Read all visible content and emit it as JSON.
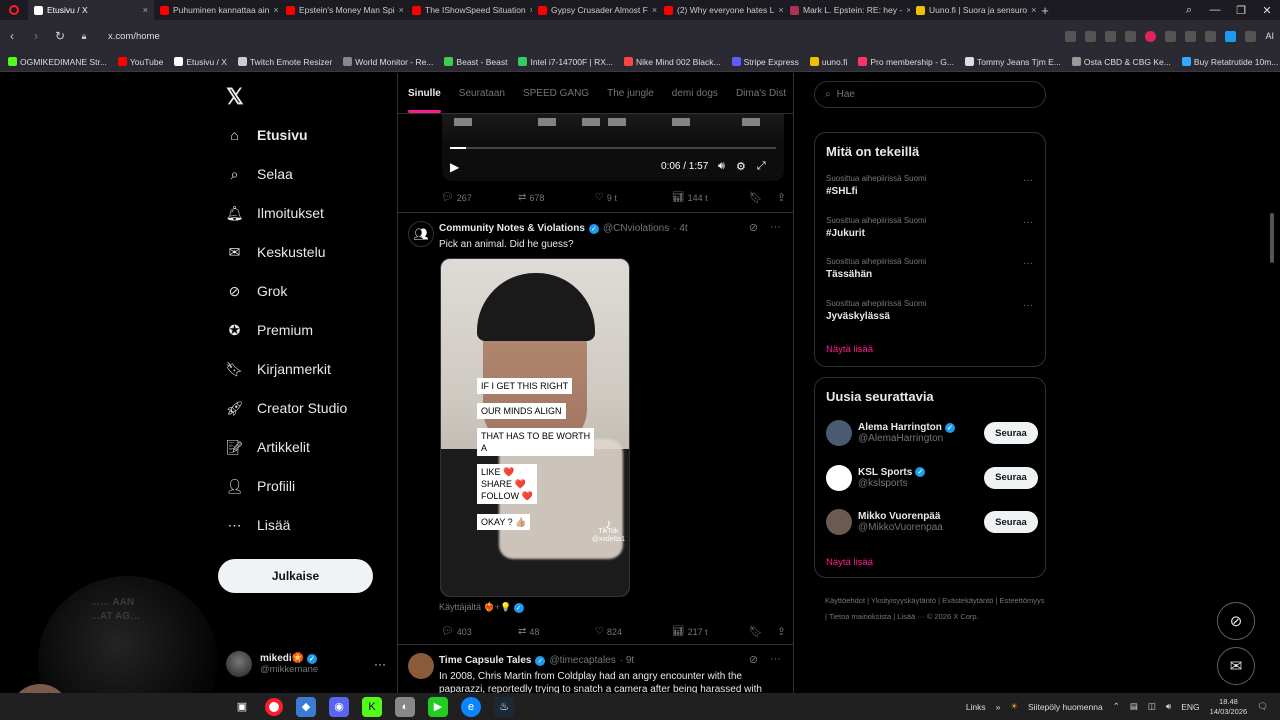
{
  "browser": {
    "tabs": [
      {
        "title": "Etusivu / X",
        "color": "#ffffff",
        "active": true
      },
      {
        "title": "Puhuminen kannattaa ain",
        "color": "#ff0000",
        "active": false
      },
      {
        "title": "Epstein's Money Man Spi",
        "color": "#ff0000",
        "active": false
      },
      {
        "title": "The IShowSpeed Situation",
        "color": "#ff0000",
        "active": false
      },
      {
        "title": "Gypsy Crusader Almost F",
        "color": "#ff0000",
        "active": false
      },
      {
        "title": "(2) Why everyone hates L",
        "color": "#ff0000",
        "active": false
      },
      {
        "title": "Mark L. Epstein: RE: hey -",
        "color": "#aa3355",
        "active": false
      },
      {
        "title": "Uuno.fi | Suora ja sensuro",
        "color": "#f0c000",
        "active": false
      }
    ],
    "url": "x.com/home",
    "ai_label": "AI",
    "bookmarks": [
      {
        "label": "OGMIKEDIMANE Str...",
        "color": "#53fc18"
      },
      {
        "label": "YouTube",
        "color": "#ff0000"
      },
      {
        "label": "Etusivu / X",
        "color": "#ffffff"
      },
      {
        "label": "Twitch Emote Resizer",
        "color": "#cccccc"
      },
      {
        "label": "World Monitor - Re...",
        "color": "#888888"
      },
      {
        "label": "Beast - Beast",
        "color": "#3ccf4e"
      },
      {
        "label": "Intel i7-14700F | RX...",
        "color": "#33cc66"
      },
      {
        "label": "Nike Mind 002 Black...",
        "color": "#ff4444"
      },
      {
        "label": "Stripe Express",
        "color": "#635bff"
      },
      {
        "label": "uuno.fi",
        "color": "#f0c000"
      },
      {
        "label": "Pro membership - G...",
        "color": "#ff3366"
      },
      {
        "label": "Tommy Jeans Tjm E...",
        "color": "#dddddd"
      },
      {
        "label": "Osta CBD & CBG Ke...",
        "color": "#999999"
      },
      {
        "label": "Buy Retatrutide 10m...",
        "color": "#33aaff"
      }
    ]
  },
  "nav": {
    "items": [
      {
        "label": "Etusivu",
        "icon": "home-icon",
        "glyph": "⌂",
        "active": true
      },
      {
        "label": "Selaa",
        "icon": "search-icon",
        "glyph": "⌕",
        "active": false
      },
      {
        "label": "Ilmoitukset",
        "icon": "bell-icon",
        "glyph": "🔔︎",
        "active": false
      },
      {
        "label": "Keskustelu",
        "icon": "mail-icon",
        "glyph": "✉",
        "active": false
      },
      {
        "label": "Grok",
        "icon": "grok-icon",
        "glyph": "⊘",
        "active": false
      },
      {
        "label": "Premium",
        "icon": "premium-icon",
        "glyph": "✪",
        "active": false
      },
      {
        "label": "Kirjanmerkit",
        "icon": "bookmark-icon",
        "glyph": "🔖︎",
        "active": false
      },
      {
        "label": "Creator Studio",
        "icon": "rocket-icon",
        "glyph": "🚀︎",
        "active": false
      },
      {
        "label": "Artikkelit",
        "icon": "article-icon",
        "glyph": "📝︎",
        "active": false
      },
      {
        "label": "Profiili",
        "icon": "profile-icon",
        "glyph": "👤︎",
        "active": false
      },
      {
        "label": "Lisää",
        "icon": "more-icon",
        "glyph": "⋯",
        "active": false
      }
    ],
    "post_button": "Julkaise",
    "profile": {
      "name": "mikedi",
      "emoji": "🏵️",
      "handle": "@mikkemane"
    }
  },
  "feed": {
    "tabs": [
      "Sinulle",
      "Seurataan",
      "SPEED GANG",
      "The jungle",
      "demi dogs",
      "Dima's Dist"
    ],
    "active_tab": "Sinulle",
    "prev_video": {
      "time": "0:06 / 1:57",
      "progress": 0.05
    },
    "prev_actions": {
      "replies": "267",
      "reposts": "678",
      "likes": "9 t",
      "views": "144 t"
    },
    "tweet": {
      "name": "Community Notes & Violations",
      "handle": "@CNviolations",
      "time": "· 4t",
      "text": "Pick an animal. Did he guess?",
      "captions": [
        "IF I GET THIS RIGHT",
        "OUR MINDS ALIGN",
        "THAT HAS TO BE WORTH\nA",
        "LIKE ❤️\nSHARE ❤️\nFOLLOW ❤️",
        "OKAY ? 👍🏼"
      ],
      "tiktok_label": "TikTok",
      "tiktok_user": "@xxdelta1",
      "via": "Käyttäjältä ❤️‍🔥+💡",
      "actions": {
        "replies": "403",
        "reposts": "48",
        "likes": "824",
        "views": "217 t"
      }
    },
    "next_tweet": {
      "name": "Time Capsule Tales",
      "handle": "@timecaptales",
      "time": "· 9t",
      "text": "In 2008, Chris Martin from Coldplay had an angry encounter with the paparazzi, reportedly trying to snatch a camera after being harassed with"
    }
  },
  "sidebar": {
    "search_placeholder": "Hae",
    "trends_title": "Mitä on tekeillä",
    "trends": [
      {
        "meta": "Suosittua aihepiirissä Suomi",
        "name": "#SHLfi"
      },
      {
        "meta": "Suosittua aihepiirissä Suomi",
        "name": "#Jukurit"
      },
      {
        "meta": "Suosittua aihepiirissä Suomi",
        "name": "Tässähän"
      },
      {
        "meta": "Suosittua aihepiirissä Suomi",
        "name": "Jyväskylässä"
      }
    ],
    "show_more": "Näytä lisää",
    "who_title": "Uusia seurattavia",
    "suggestions": [
      {
        "name": "Alema Harrington",
        "handle": "@AlemaHarrington",
        "verified": true,
        "avatar_color": "#4a5a70"
      },
      {
        "name": "KSL Sports",
        "handle": "@kslsports",
        "verified": true,
        "avatar_color": "#ffffff"
      },
      {
        "name": "Mikko Vuorenpää",
        "handle": "@MikkoVuorenpaa",
        "verified": false,
        "avatar_color": "#6a5a50"
      }
    ],
    "follow_label": "Seuraa",
    "footer": "Käyttöehdot | Yksityisyyskäytäntö | Evästekäytäntö | Esteettömyys | Tietoa mainoksista | Lisää ··· © 2026 X Corp."
  },
  "webcam": {
    "text_line1": "…… AAN",
    "text_line2": "…AT AG…"
  },
  "taskbar": {
    "links": "Links",
    "weather": "Siitepöly huomenna",
    "lang": "ENG",
    "time": "18.48",
    "date": "14/03/2026"
  },
  "colors": {
    "accent": "#ff1a8c",
    "verified": "#1d9bf0",
    "border": "#2f3336"
  }
}
